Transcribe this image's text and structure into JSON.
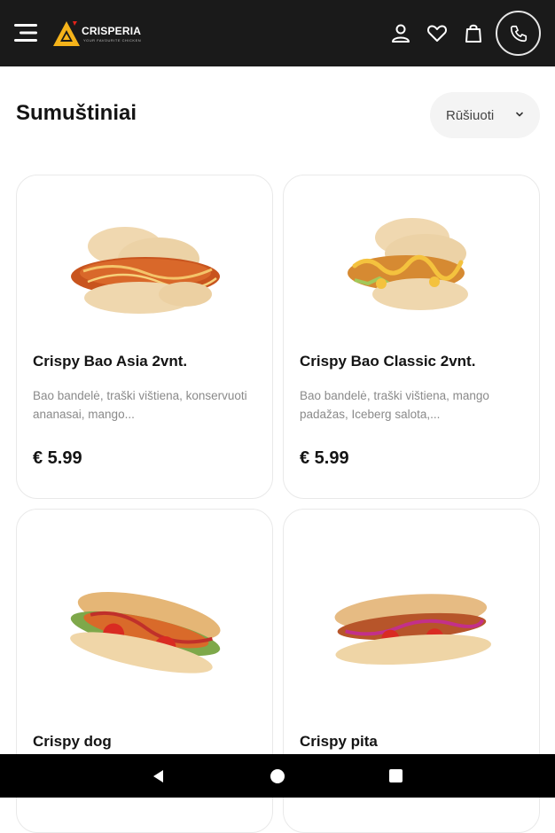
{
  "header": {
    "brand": "CRISPERIA",
    "tagline": "YOUR FAVOURITE CHICKEN"
  },
  "page": {
    "title": "Sumuštiniai",
    "sort_label": "Rūšiuoti"
  },
  "products": [
    {
      "name": "Crispy Bao Asia 2vnt.",
      "desc": "Bao bandelė, traški vištiena, konservuoti ananasai, mango...",
      "price": "€ 5.99",
      "image": "bao-asia"
    },
    {
      "name": "Crispy Bao Classic 2vnt.",
      "desc": "Bao bandelė, traški vištiena, mango padažas, Iceberg salota,...",
      "price": "€ 5.99",
      "image": "bao-classic"
    },
    {
      "name": "Crispy dog",
      "desc": "",
      "price": "",
      "image": "hot-dog"
    },
    {
      "name": "Crispy pita",
      "desc": "",
      "price": "",
      "image": "pita"
    }
  ],
  "colors": {
    "header_bg": "#1a1a1a",
    "logo_accent": "#f5b31a",
    "logo_accent_red": "#e2231a",
    "sort_bg": "#f4f4f4",
    "card_border": "#e9e9e9",
    "desc_text": "#8a8a8a"
  },
  "icons": [
    "menu-icon",
    "user-icon",
    "heart-icon",
    "shopping-bag-icon",
    "phone-icon",
    "chevron-down-icon",
    "back-icon",
    "home-icon",
    "recents-icon"
  ]
}
